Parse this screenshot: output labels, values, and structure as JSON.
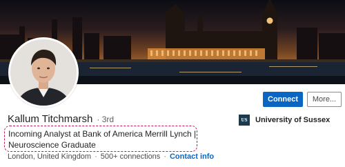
{
  "profile": {
    "name": "Kallum Titchmarsh",
    "degree": "· 3rd",
    "headline_line1": "Incoming Analyst at Bank of America Merrill Lynch |",
    "headline_line2": "Neuroscience Graduate",
    "location": "London, United Kingdom",
    "connections": "500+ connections",
    "contact_link": "Contact info",
    "separator": "·"
  },
  "actions": {
    "connect_label": "Connect",
    "more_label": "More..."
  },
  "education": {
    "school_name": "University of Sussex",
    "logo_text": "US"
  },
  "banner": {
    "icon": "london-skyline-banner"
  },
  "colors": {
    "primary": "#0a66c2",
    "highlight": "#c2185b",
    "logo_bg": "#1b3a4b"
  }
}
